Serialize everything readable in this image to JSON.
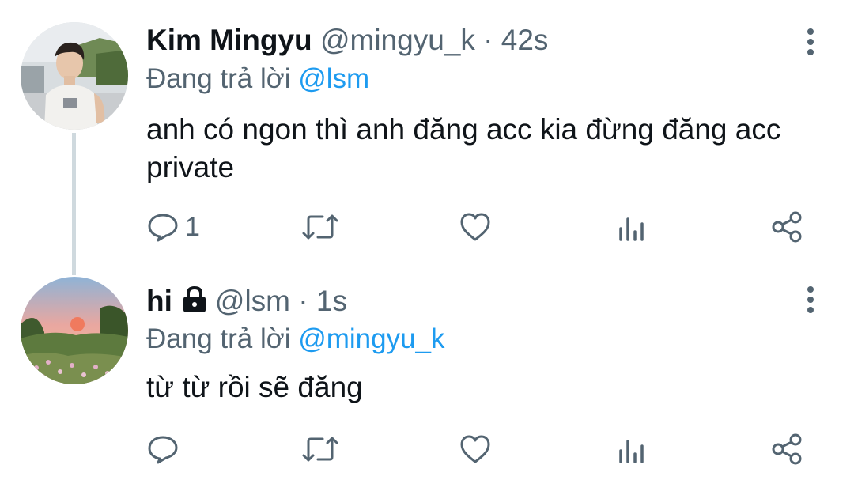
{
  "tweets": [
    {
      "name": "Kim Mingyu",
      "handle": "@mingyu_k",
      "separator": "·",
      "time": "42s",
      "replying_prefix": "Đang trả lời",
      "replying_to": "@lsm",
      "text": "anh có ngon thì anh đăng acc kia đừng đăng acc private",
      "reply_count": "1",
      "protected": false
    },
    {
      "name": "hi",
      "handle": "@lsm",
      "separator": "·",
      "time": "1s",
      "replying_prefix": "Đang trả lời",
      "replying_to": "@mingyu_k",
      "text": "từ từ rồi sẽ đăng",
      "reply_count": "",
      "protected": true
    }
  ],
  "icons": {
    "reply": "reply-icon",
    "retweet": "retweet-icon",
    "like": "heart-icon",
    "stats": "stats-icon",
    "share": "share-icon",
    "more": "more-vertical-icon",
    "lock": "lock-icon"
  },
  "colors": {
    "text": "#0f1419",
    "secondary": "#536471",
    "link": "#1d9bf0",
    "thread_line": "#cfd9de"
  }
}
